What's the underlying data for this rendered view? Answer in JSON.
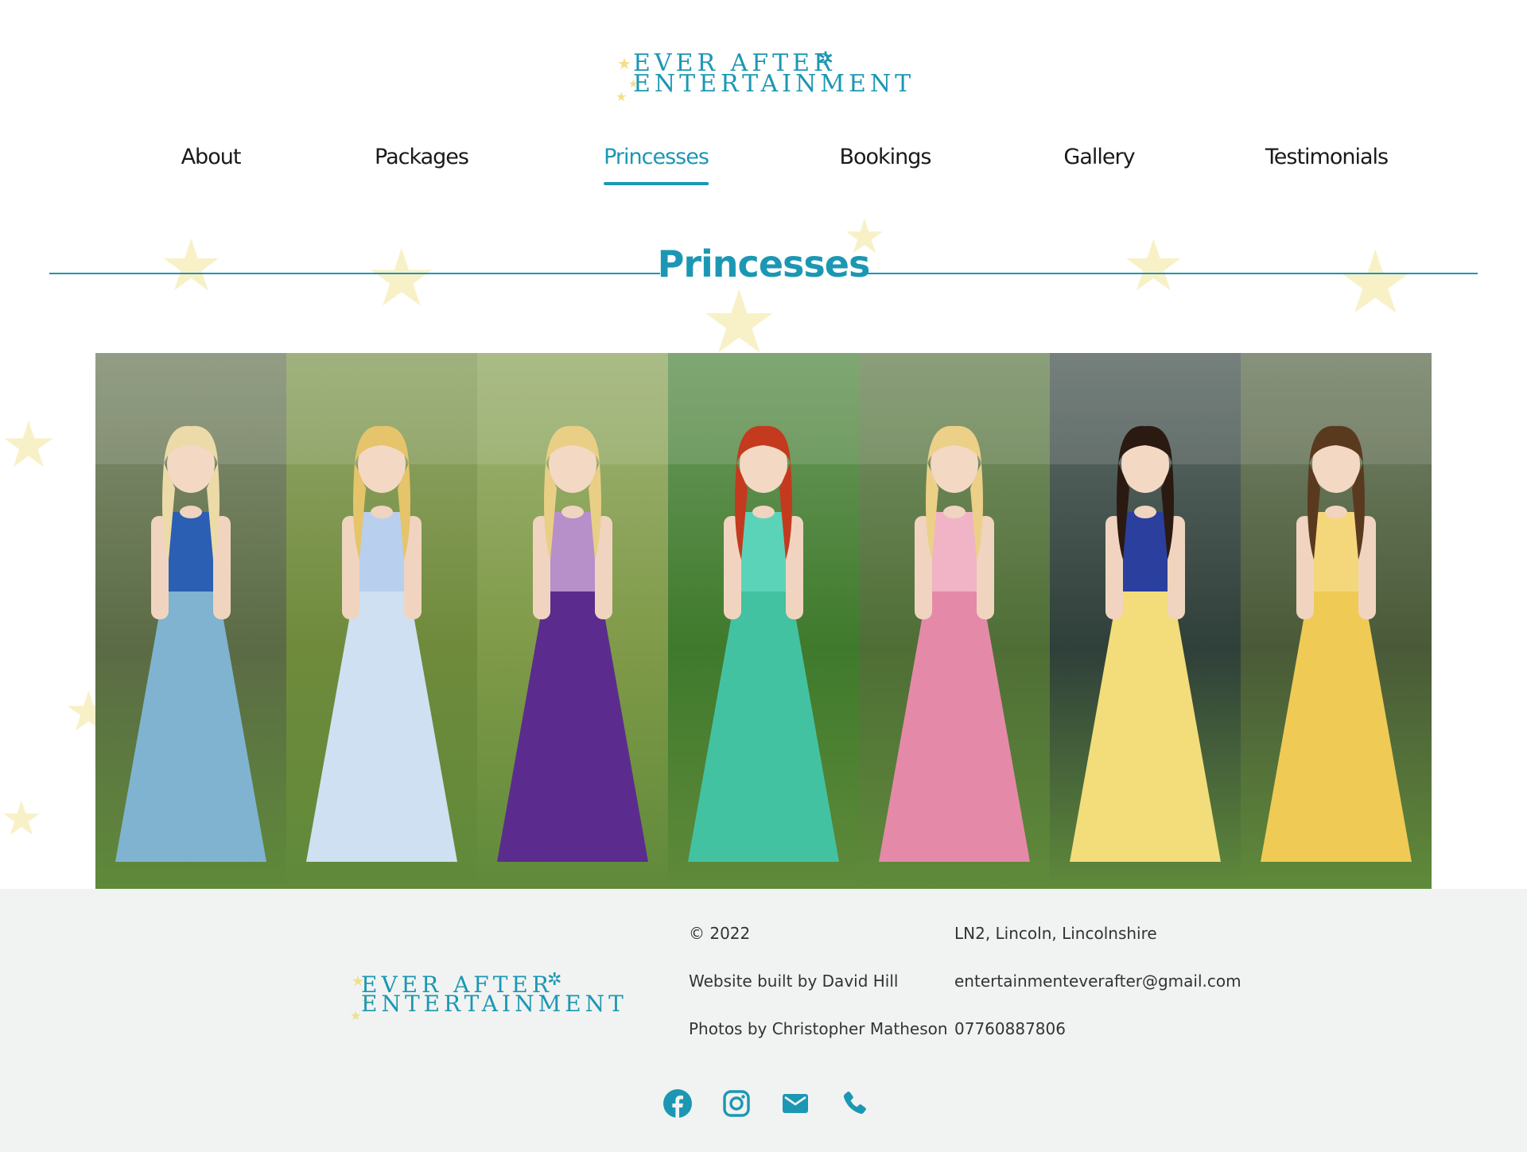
{
  "brand": {
    "logo_line1": "EVER AFTER",
    "logo_line2": "ENTERTAINMENT",
    "accent_color": "#1c97b3",
    "star_color": "#f1df8a"
  },
  "nav": {
    "items": [
      {
        "label": "About",
        "active": false
      },
      {
        "label": "Packages",
        "active": false
      },
      {
        "label": "Princesses",
        "active": true
      },
      {
        "label": "Bookings",
        "active": false
      },
      {
        "label": "Gallery",
        "active": false
      },
      {
        "label": "Testimonials",
        "active": false
      }
    ]
  },
  "page": {
    "title": "Princesses"
  },
  "gallery": {
    "images": [
      {
        "name": "frozen-sisters-photo",
        "dress": "#7fb3d0",
        "dress2": "#2a5fb3",
        "hair": "#ecdba8",
        "bg": "#5b6b45"
      },
      {
        "name": "cinderella-photo",
        "dress": "#cfe0f2",
        "dress2": "#b8d0ee",
        "hair": "#e5c46b",
        "bg": "#6f8a3b"
      },
      {
        "name": "rapunzel-photo",
        "dress": "#5b2c8e",
        "dress2": "#b78fc9",
        "hair": "#e9cf86",
        "bg": "#7f9a48"
      },
      {
        "name": "ariel-photo",
        "dress": "#43c2a2",
        "dress2": "#5bd3b8",
        "hair": "#c43a1f",
        "bg": "#3f7a2c"
      },
      {
        "name": "aurora-photo",
        "dress": "#e48aa8",
        "dress2": "#f1b3c6",
        "hair": "#ecd088",
        "bg": "#4f6e36"
      },
      {
        "name": "snow-white-photo",
        "dress": "#f3dc7a",
        "dress2": "#2b3f9e",
        "hair": "#2a1a12",
        "bg": "#2f3f3a"
      },
      {
        "name": "belle-photo",
        "dress": "#efca55",
        "dress2": "#f4d77a",
        "hair": "#5a3a1e",
        "bg": "#4a5a38"
      }
    ]
  },
  "footer": {
    "copyright": "© 2022",
    "built_by": "Website built by David Hill",
    "photos_by": "Photos by Christopher Matheson",
    "location": "LN2, Lincoln, Lincolnshire",
    "email": "entertainmenteverafter@gmail.com",
    "phone": "07760887806",
    "background": "#f1f3f2"
  },
  "social": [
    {
      "icon": "facebook-icon"
    },
    {
      "icon": "instagram-icon"
    },
    {
      "icon": "email-icon"
    },
    {
      "icon": "phone-icon"
    }
  ]
}
